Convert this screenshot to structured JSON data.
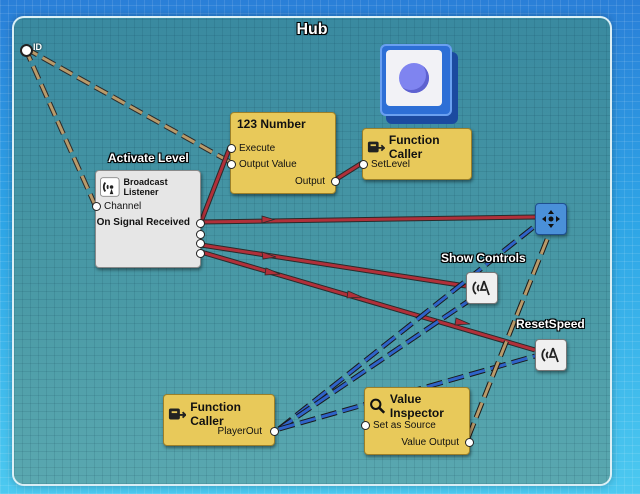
{
  "hub": {
    "title": "Hub"
  },
  "id_port": {
    "label": "ID"
  },
  "nodes": {
    "number": {
      "title": "123 Number",
      "execute": "Execute",
      "output_value": "Output Value",
      "output": "Output"
    },
    "function_caller_top": {
      "title": "Function Caller",
      "port": "SetLevel"
    },
    "activate_level": {
      "label": "Activate Level",
      "type": "Broadcast Listener",
      "channel": "Channel",
      "on_signal": "On Signal Received"
    },
    "show_controls": {
      "label": "Show Controls"
    },
    "reset_speed": {
      "label": "ResetSpeed"
    },
    "function_caller_bottom": {
      "title": "Function Caller",
      "port": "PlayerOut"
    },
    "value_inspector": {
      "title": "Value Inspector",
      "set_source": "Set as Source",
      "value_output": "Value Output"
    }
  },
  "colors": {
    "node_yellow": "#e8c95a",
    "node_white": "#e6e6e6",
    "wire_signal": "#b0303a",
    "wire_data_tan": "#b89a6a",
    "wire_data_blue": "#2f63c8",
    "accent_cube": "#2d6fd6"
  },
  "icons": [
    "broadcast-icon",
    "function-caller-icon",
    "magnifier-icon",
    "gravity-icon",
    "move-arrows-icon",
    "cube-icon"
  ]
}
